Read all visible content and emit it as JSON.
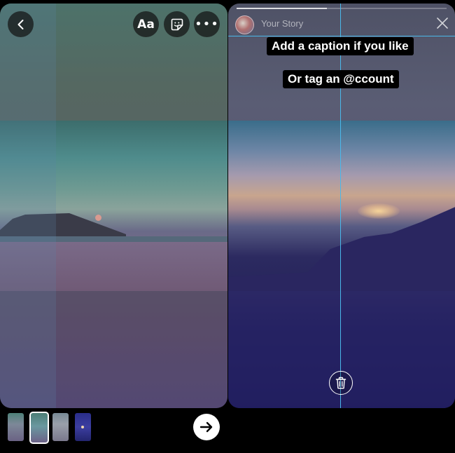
{
  "editor": {
    "text_button_label": "Aa",
    "more_button_label": "•••",
    "icons": {
      "back": "chevron-left-icon",
      "sticker": "sticker-icon",
      "more": "more-icon"
    }
  },
  "preview": {
    "story_title": "Your Story",
    "story_progress": 0.43,
    "caption_line_1": "Add a caption if you like",
    "caption_line_2": "Or tag an @ccount",
    "guide_color": "#4ab8ea",
    "icons": {
      "close": "close-icon",
      "trash": "trash-icon"
    }
  },
  "bottom_bar": {
    "thumbnails": [
      {
        "name": "thumbnail-1",
        "selected": false
      },
      {
        "name": "thumbnail-2",
        "selected": true
      },
      {
        "name": "thumbnail-3",
        "selected": false
      },
      {
        "name": "thumbnail-4",
        "selected": false
      }
    ],
    "next_icon": "arrow-right-icon"
  }
}
